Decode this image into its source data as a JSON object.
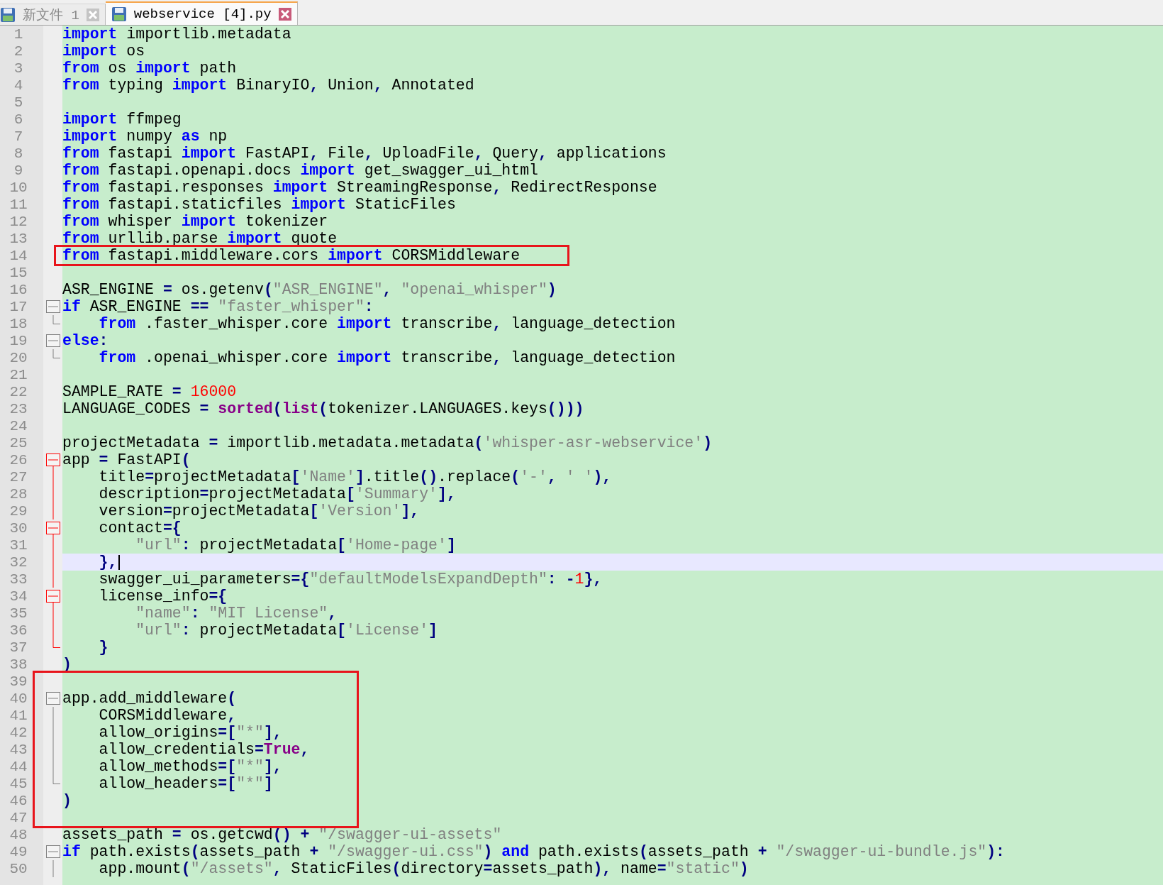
{
  "tabs": [
    {
      "label": "新文件 1",
      "selected": false
    },
    {
      "label": "webservice [4].py",
      "selected": true
    }
  ],
  "lines": [
    {
      "number": "1",
      "kind": "plain",
      "tokens": [
        {
          "kind": "keyword",
          "text": "import"
        },
        {
          "kind": "plain",
          "text": " importlib.metadata"
        }
      ]
    },
    {
      "number": "2",
      "kind": "plain",
      "tokens": [
        {
          "kind": "keyword",
          "text": "import"
        },
        {
          "kind": "plain",
          "text": " os"
        }
      ]
    },
    {
      "number": "3",
      "kind": "plain",
      "tokens": [
        {
          "kind": "keyword",
          "text": "from"
        },
        {
          "kind": "plain",
          "text": " os "
        },
        {
          "kind": "keyword",
          "text": "import"
        },
        {
          "kind": "plain",
          "text": " path"
        }
      ]
    },
    {
      "number": "4",
      "kind": "plain",
      "tokens": [
        {
          "kind": "keyword",
          "text": "from"
        },
        {
          "kind": "plain",
          "text": " typing "
        },
        {
          "kind": "keyword",
          "text": "import"
        },
        {
          "kind": "plain",
          "text": " BinaryIO"
        },
        {
          "kind": "operator",
          "text": ","
        },
        {
          "kind": "plain",
          "text": " Union"
        },
        {
          "kind": "operator",
          "text": ","
        },
        {
          "kind": "plain",
          "text": " Annotated"
        }
      ]
    },
    {
      "number": "5",
      "kind": "plain"
    },
    {
      "number": "6",
      "kind": "plain",
      "tokens": [
        {
          "kind": "keyword",
          "text": "import"
        },
        {
          "kind": "plain",
          "text": " ffmpeg"
        }
      ]
    },
    {
      "number": "7",
      "kind": "plain",
      "tokens": [
        {
          "kind": "keyword",
          "text": "import"
        },
        {
          "kind": "plain",
          "text": " numpy "
        },
        {
          "kind": "keyword",
          "text": "as"
        },
        {
          "kind": "plain",
          "text": " np"
        }
      ]
    },
    {
      "number": "8",
      "kind": "plain",
      "tokens": [
        {
          "kind": "keyword",
          "text": "from"
        },
        {
          "kind": "plain",
          "text": " fastapi "
        },
        {
          "kind": "keyword",
          "text": "import"
        },
        {
          "kind": "plain",
          "text": " FastAPI"
        },
        {
          "kind": "operator",
          "text": ","
        },
        {
          "kind": "plain",
          "text": " File"
        },
        {
          "kind": "operator",
          "text": ","
        },
        {
          "kind": "plain",
          "text": " UploadFile"
        },
        {
          "kind": "operator",
          "text": ","
        },
        {
          "kind": "plain",
          "text": " Query"
        },
        {
          "kind": "operator",
          "text": ","
        },
        {
          "kind": "plain",
          "text": " applications"
        }
      ]
    },
    {
      "number": "9",
      "kind": "plain",
      "tokens": [
        {
          "kind": "keyword",
          "text": "from"
        },
        {
          "kind": "plain",
          "text": " fastapi.openapi.docs "
        },
        {
          "kind": "keyword",
          "text": "import"
        },
        {
          "kind": "plain",
          "text": " get_swagger_ui_html"
        }
      ]
    },
    {
      "number": "10",
      "kind": "plain",
      "tokens": [
        {
          "kind": "keyword",
          "text": "from"
        },
        {
          "kind": "plain",
          "text": " fastapi.responses "
        },
        {
          "kind": "keyword",
          "text": "import"
        },
        {
          "kind": "plain",
          "text": " StreamingResponse"
        },
        {
          "kind": "operator",
          "text": ","
        },
        {
          "kind": "plain",
          "text": " RedirectResponse"
        }
      ]
    },
    {
      "number": "11",
      "kind": "plain",
      "tokens": [
        {
          "kind": "keyword",
          "text": "from"
        },
        {
          "kind": "plain",
          "text": " fastapi.staticfiles "
        },
        {
          "kind": "keyword",
          "text": "import"
        },
        {
          "kind": "plain",
          "text": " StaticFiles"
        }
      ]
    },
    {
      "number": "12",
      "kind": "plain",
      "tokens": [
        {
          "kind": "keyword",
          "text": "from"
        },
        {
          "kind": "plain",
          "text": " whisper "
        },
        {
          "kind": "keyword",
          "text": "import"
        },
        {
          "kind": "plain",
          "text": " tokenizer"
        }
      ]
    },
    {
      "number": "13",
      "kind": "plain",
      "tokens": [
        {
          "kind": "keyword",
          "text": "from"
        },
        {
          "kind": "plain",
          "text": " urllib.parse "
        },
        {
          "kind": "keyword",
          "text": "import"
        },
        {
          "kind": "plain",
          "text": " quote"
        }
      ]
    },
    {
      "number": "14",
      "kind": "plain",
      "boxed": true,
      "tokens": [
        {
          "kind": "keyword",
          "text": "from"
        },
        {
          "kind": "plain",
          "text": " fastapi.middleware.cors "
        },
        {
          "kind": "keyword",
          "text": "import"
        },
        {
          "kind": "plain",
          "text": " CORSMiddleware"
        }
      ]
    },
    {
      "number": "15",
      "kind": "plain"
    },
    {
      "number": "16",
      "kind": "plain",
      "tokens": [
        {
          "kind": "plain",
          "text": "ASR_ENGINE "
        },
        {
          "kind": "operator",
          "text": "="
        },
        {
          "kind": "plain",
          "text": " os.getenv"
        },
        {
          "kind": "operator",
          "text": "("
        },
        {
          "kind": "string",
          "text": "\"ASR_ENGINE\""
        },
        {
          "kind": "operator",
          "text": ", "
        },
        {
          "kind": "string",
          "text": "\"openai_whisper\""
        },
        {
          "kind": "operator",
          "text": ")"
        }
      ]
    },
    {
      "number": "17",
      "kind": "fold_start",
      "tokens": [
        {
          "kind": "keyword",
          "text": "if"
        },
        {
          "kind": "plain",
          "text": " ASR_ENGINE "
        },
        {
          "kind": "operator",
          "text": "== "
        },
        {
          "kind": "string",
          "text": "\"faster_whisper\""
        },
        {
          "kind": "operator",
          "text": ":"
        }
      ]
    },
    {
      "number": "18",
      "kind": "fold_end",
      "tokens": [
        {
          "kind": "keyword",
          "text": "    from"
        },
        {
          "kind": "plain",
          "text": " .faster_whisper.core "
        },
        {
          "kind": "keyword",
          "text": "import"
        },
        {
          "kind": "plain",
          "text": " transcribe"
        },
        {
          "kind": "operator",
          "text": ","
        },
        {
          "kind": "plain",
          "text": " language_detection"
        }
      ]
    },
    {
      "number": "19",
      "kind": "fold_start",
      "tokens": [
        {
          "kind": "keyword",
          "text": "else"
        },
        {
          "kind": "operator",
          "text": ":"
        }
      ]
    },
    {
      "number": "20",
      "kind": "fold_end",
      "tokens": [
        {
          "kind": "keyword",
          "text": "    from"
        },
        {
          "kind": "plain",
          "text": " .openai_whisper.core "
        },
        {
          "kind": "keyword",
          "text": "import"
        },
        {
          "kind": "plain",
          "text": " transcribe"
        },
        {
          "kind": "operator",
          "text": ","
        },
        {
          "kind": "plain",
          "text": " language_detection"
        }
      ]
    },
    {
      "number": "21",
      "kind": "plain"
    },
    {
      "number": "22",
      "kind": "plain",
      "tokens": [
        {
          "kind": "plain",
          "text": "SAMPLE_RATE "
        },
        {
          "kind": "operator",
          "text": "= "
        },
        {
          "kind": "number",
          "text": "16000"
        }
      ]
    },
    {
      "number": "23",
      "kind": "plain",
      "tokens": [
        {
          "kind": "plain",
          "text": "LANGUAGE_CODES "
        },
        {
          "kind": "operator",
          "text": "= "
        },
        {
          "kind": "builtin",
          "text": "sorted"
        },
        {
          "kind": "operator",
          "text": "("
        },
        {
          "kind": "builtin",
          "text": "list"
        },
        {
          "kind": "operator",
          "text": "("
        },
        {
          "kind": "plain",
          "text": "tokenizer.LANGUAGES.keys"
        },
        {
          "kind": "operator",
          "text": "()))"
        }
      ]
    },
    {
      "number": "24",
      "kind": "plain"
    },
    {
      "number": "25",
      "kind": "plain",
      "tokens": [
        {
          "kind": "plain",
          "text": "projectMetadata "
        },
        {
          "kind": "operator",
          "text": "="
        },
        {
          "kind": "plain",
          "text": " importlib.metadata.metadata"
        },
        {
          "kind": "operator",
          "text": "("
        },
        {
          "kind": "string",
          "text": "'whisper-asr-webservice'"
        },
        {
          "kind": "operator",
          "text": ")"
        }
      ]
    },
    {
      "number": "26",
      "kind": "fold_start",
      "fold_active": true,
      "tokens": [
        {
          "kind": "plain",
          "text": "app "
        },
        {
          "kind": "operator",
          "text": "="
        },
        {
          "kind": "plain",
          "text": " FastAPI"
        },
        {
          "kind": "operator",
          "text": "("
        }
      ]
    },
    {
      "number": "27",
      "kind": "fold_body",
      "fold_active": true,
      "tokens": [
        {
          "kind": "plain",
          "text": "    title"
        },
        {
          "kind": "operator",
          "text": "="
        },
        {
          "kind": "plain",
          "text": "projectMetadata"
        },
        {
          "kind": "operator",
          "text": "["
        },
        {
          "kind": "string",
          "text": "'Name'"
        },
        {
          "kind": "operator",
          "text": "]"
        },
        {
          "kind": "plain",
          "text": ".title"
        },
        {
          "kind": "operator",
          "text": "()"
        },
        {
          "kind": "plain",
          "text": ".replace"
        },
        {
          "kind": "operator",
          "text": "("
        },
        {
          "kind": "string",
          "text": "'-'"
        },
        {
          "kind": "operator",
          "text": ", "
        },
        {
          "kind": "string",
          "text": "' '"
        },
        {
          "kind": "operator",
          "text": "),"
        }
      ]
    },
    {
      "number": "28",
      "kind": "fold_body",
      "fold_active": true,
      "tokens": [
        {
          "kind": "plain",
          "text": "    description"
        },
        {
          "kind": "operator",
          "text": "="
        },
        {
          "kind": "plain",
          "text": "projectMetadata"
        },
        {
          "kind": "operator",
          "text": "["
        },
        {
          "kind": "string",
          "text": "'Summary'"
        },
        {
          "kind": "operator",
          "text": "],"
        }
      ]
    },
    {
      "number": "29",
      "kind": "fold_body",
      "fold_active": true,
      "tokens": [
        {
          "kind": "plain",
          "text": "    version"
        },
        {
          "kind": "operator",
          "text": "="
        },
        {
          "kind": "plain",
          "text": "projectMetadata"
        },
        {
          "kind": "operator",
          "text": "["
        },
        {
          "kind": "string",
          "text": "'Version'"
        },
        {
          "kind": "operator",
          "text": "],"
        }
      ]
    },
    {
      "number": "30",
      "kind": "fold_start",
      "fold_active": true,
      "tokens": [
        {
          "kind": "plain",
          "text": "    contact"
        },
        {
          "kind": "operator",
          "text": "={"
        }
      ]
    },
    {
      "number": "31",
      "kind": "fold_body",
      "fold_active": true,
      "tokens": [
        {
          "kind": "string",
          "text": "        \"url\""
        },
        {
          "kind": "operator",
          "text": ":"
        },
        {
          "kind": "plain",
          "text": " projectMetadata"
        },
        {
          "kind": "operator",
          "text": "["
        },
        {
          "kind": "string",
          "text": "'Home-page'"
        },
        {
          "kind": "operator",
          "text": "]"
        }
      ]
    },
    {
      "number": "32",
      "kind": "fold_body",
      "fold_active": true,
      "current": true,
      "tokens": [
        {
          "kind": "operator",
          "text": "    },"
        }
      ]
    },
    {
      "number": "33",
      "kind": "fold_body",
      "fold_active": true,
      "tokens": [
        {
          "kind": "plain",
          "text": "    swagger_ui_parameters"
        },
        {
          "kind": "operator",
          "text": "={"
        },
        {
          "kind": "string",
          "text": "\"defaultModelsExpandDepth\""
        },
        {
          "kind": "operator",
          "text": ": -"
        },
        {
          "kind": "number",
          "text": "1"
        },
        {
          "kind": "operator",
          "text": "},"
        }
      ]
    },
    {
      "number": "34",
      "kind": "fold_start",
      "fold_active": true,
      "tokens": [
        {
          "kind": "plain",
          "text": "    license_info"
        },
        {
          "kind": "operator",
          "text": "={"
        }
      ]
    },
    {
      "number": "35",
      "kind": "fold_body",
      "fold_active": true,
      "tokens": [
        {
          "kind": "string",
          "text": "        \"name\""
        },
        {
          "kind": "operator",
          "text": ": "
        },
        {
          "kind": "string",
          "text": "\"MIT License\""
        },
        {
          "kind": "operator",
          "text": ","
        }
      ]
    },
    {
      "number": "36",
      "kind": "fold_body",
      "fold_active": true,
      "tokens": [
        {
          "kind": "string",
          "text": "        \"url\""
        },
        {
          "kind": "operator",
          "text": ":"
        },
        {
          "kind": "plain",
          "text": " projectMetadata"
        },
        {
          "kind": "operator",
          "text": "["
        },
        {
          "kind": "string",
          "text": "'License'"
        },
        {
          "kind": "operator",
          "text": "]"
        }
      ]
    },
    {
      "number": "37",
      "kind": "fold_end",
      "fold_active": true,
      "tokens": [
        {
          "kind": "operator",
          "text": "    }"
        }
      ]
    },
    {
      "number": "38",
      "kind": "plain",
      "tokens": [
        {
          "kind": "operator",
          "text": ")"
        }
      ]
    },
    {
      "number": "39",
      "kind": "plain",
      "boxed": true
    },
    {
      "number": "40",
      "kind": "fold_start",
      "boxed": true,
      "tokens": [
        {
          "kind": "plain",
          "text": "app.add_middleware"
        },
        {
          "kind": "operator",
          "text": "("
        }
      ]
    },
    {
      "number": "41",
      "kind": "fold_body",
      "boxed": true,
      "tokens": [
        {
          "kind": "plain",
          "text": "    CORSMiddleware"
        },
        {
          "kind": "operator",
          "text": ","
        }
      ]
    },
    {
      "number": "42",
      "kind": "fold_body",
      "boxed": true,
      "tokens": [
        {
          "kind": "plain",
          "text": "    allow_origins"
        },
        {
          "kind": "operator",
          "text": "=["
        },
        {
          "kind": "string",
          "text": "\"*\""
        },
        {
          "kind": "operator",
          "text": "],"
        }
      ]
    },
    {
      "number": "43",
      "kind": "fold_body",
      "boxed": true,
      "tokens": [
        {
          "kind": "plain",
          "text": "    allow_credentials"
        },
        {
          "kind": "operator",
          "text": "="
        },
        {
          "kind": "builtin",
          "text": "True"
        },
        {
          "kind": "operator",
          "text": ","
        }
      ]
    },
    {
      "number": "44",
      "kind": "fold_body",
      "boxed": true,
      "tokens": [
        {
          "kind": "plain",
          "text": "    allow_methods"
        },
        {
          "kind": "operator",
          "text": "=["
        },
        {
          "kind": "string",
          "text": "\"*\""
        },
        {
          "kind": "operator",
          "text": "],"
        }
      ]
    },
    {
      "number": "45",
      "kind": "fold_end",
      "boxed": true,
      "tokens": [
        {
          "kind": "plain",
          "text": "    allow_headers"
        },
        {
          "kind": "operator",
          "text": "=["
        },
        {
          "kind": "string",
          "text": "\"*\""
        },
        {
          "kind": "operator",
          "text": "]"
        }
      ]
    },
    {
      "number": "46",
      "kind": "plain",
      "boxed": true,
      "tokens": [
        {
          "kind": "operator",
          "text": ")"
        }
      ]
    },
    {
      "number": "47",
      "kind": "plain",
      "boxed": true
    },
    {
      "number": "48",
      "kind": "plain",
      "tokens": [
        {
          "kind": "plain",
          "text": "assets_path "
        },
        {
          "kind": "operator",
          "text": "="
        },
        {
          "kind": "plain",
          "text": " os.getcwd"
        },
        {
          "kind": "operator",
          "text": "() + "
        },
        {
          "kind": "string",
          "text": "\"/swagger-ui-assets\""
        }
      ]
    },
    {
      "number": "49",
      "kind": "fold_start",
      "tokens": [
        {
          "kind": "keyword",
          "text": "if"
        },
        {
          "kind": "plain",
          "text": " path.exists"
        },
        {
          "kind": "operator",
          "text": "("
        },
        {
          "kind": "plain",
          "text": "assets_path "
        },
        {
          "kind": "operator",
          "text": "+ "
        },
        {
          "kind": "string",
          "text": "\"/swagger-ui.css\""
        },
        {
          "kind": "operator",
          "text": ") "
        },
        {
          "kind": "keyword",
          "text": "and"
        },
        {
          "kind": "plain",
          "text": " path.exists"
        },
        {
          "kind": "operator",
          "text": "("
        },
        {
          "kind": "plain",
          "text": "assets_path "
        },
        {
          "kind": "operator",
          "text": "+ "
        },
        {
          "kind": "string",
          "text": "\"/swagger-ui-bundle.js\""
        },
        {
          "kind": "operator",
          "text": "):"
        }
      ]
    },
    {
      "number": "50",
      "kind": "fold_body",
      "tokens": [
        {
          "kind": "plain",
          "text": "    app.mount"
        },
        {
          "kind": "operator",
          "text": "("
        },
        {
          "kind": "string",
          "text": "\"/assets\""
        },
        {
          "kind": "operator",
          "text": ","
        },
        {
          "kind": "plain",
          "text": " StaticFiles"
        },
        {
          "kind": "operator",
          "text": "("
        },
        {
          "kind": "plain",
          "text": "directory"
        },
        {
          "kind": "operator",
          "text": "="
        },
        {
          "kind": "plain",
          "text": "assets_path"
        },
        {
          "kind": "operator",
          "text": "),"
        },
        {
          "kind": "plain",
          "text": " name"
        },
        {
          "kind": "operator",
          "text": "="
        },
        {
          "kind": "string",
          "text": "\"static\""
        },
        {
          "kind": "operator",
          "text": ")"
        }
      ]
    }
  ]
}
